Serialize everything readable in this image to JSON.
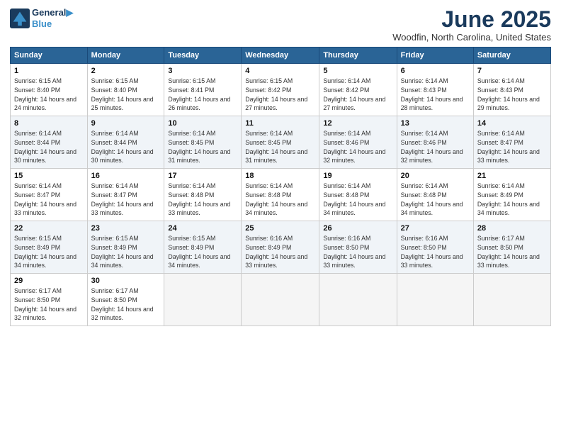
{
  "header": {
    "logo_line1": "General",
    "logo_line2": "Blue",
    "month": "June 2025",
    "location": "Woodfin, North Carolina, United States"
  },
  "columns": [
    "Sunday",
    "Monday",
    "Tuesday",
    "Wednesday",
    "Thursday",
    "Friday",
    "Saturday"
  ],
  "weeks": [
    [
      {
        "day": "1",
        "sunrise": "Sunrise: 6:15 AM",
        "sunset": "Sunset: 8:40 PM",
        "daylight": "Daylight: 14 hours and 24 minutes."
      },
      {
        "day": "2",
        "sunrise": "Sunrise: 6:15 AM",
        "sunset": "Sunset: 8:40 PM",
        "daylight": "Daylight: 14 hours and 25 minutes."
      },
      {
        "day": "3",
        "sunrise": "Sunrise: 6:15 AM",
        "sunset": "Sunset: 8:41 PM",
        "daylight": "Daylight: 14 hours and 26 minutes."
      },
      {
        "day": "4",
        "sunrise": "Sunrise: 6:15 AM",
        "sunset": "Sunset: 8:42 PM",
        "daylight": "Daylight: 14 hours and 27 minutes."
      },
      {
        "day": "5",
        "sunrise": "Sunrise: 6:14 AM",
        "sunset": "Sunset: 8:42 PM",
        "daylight": "Daylight: 14 hours and 27 minutes."
      },
      {
        "day": "6",
        "sunrise": "Sunrise: 6:14 AM",
        "sunset": "Sunset: 8:43 PM",
        "daylight": "Daylight: 14 hours and 28 minutes."
      },
      {
        "day": "7",
        "sunrise": "Sunrise: 6:14 AM",
        "sunset": "Sunset: 8:43 PM",
        "daylight": "Daylight: 14 hours and 29 minutes."
      }
    ],
    [
      {
        "day": "8",
        "sunrise": "Sunrise: 6:14 AM",
        "sunset": "Sunset: 8:44 PM",
        "daylight": "Daylight: 14 hours and 30 minutes."
      },
      {
        "day": "9",
        "sunrise": "Sunrise: 6:14 AM",
        "sunset": "Sunset: 8:44 PM",
        "daylight": "Daylight: 14 hours and 30 minutes."
      },
      {
        "day": "10",
        "sunrise": "Sunrise: 6:14 AM",
        "sunset": "Sunset: 8:45 PM",
        "daylight": "Daylight: 14 hours and 31 minutes."
      },
      {
        "day": "11",
        "sunrise": "Sunrise: 6:14 AM",
        "sunset": "Sunset: 8:45 PM",
        "daylight": "Daylight: 14 hours and 31 minutes."
      },
      {
        "day": "12",
        "sunrise": "Sunrise: 6:14 AM",
        "sunset": "Sunset: 8:46 PM",
        "daylight": "Daylight: 14 hours and 32 minutes."
      },
      {
        "day": "13",
        "sunrise": "Sunrise: 6:14 AM",
        "sunset": "Sunset: 8:46 PM",
        "daylight": "Daylight: 14 hours and 32 minutes."
      },
      {
        "day": "14",
        "sunrise": "Sunrise: 6:14 AM",
        "sunset": "Sunset: 8:47 PM",
        "daylight": "Daylight: 14 hours and 33 minutes."
      }
    ],
    [
      {
        "day": "15",
        "sunrise": "Sunrise: 6:14 AM",
        "sunset": "Sunset: 8:47 PM",
        "daylight": "Daylight: 14 hours and 33 minutes."
      },
      {
        "day": "16",
        "sunrise": "Sunrise: 6:14 AM",
        "sunset": "Sunset: 8:47 PM",
        "daylight": "Daylight: 14 hours and 33 minutes."
      },
      {
        "day": "17",
        "sunrise": "Sunrise: 6:14 AM",
        "sunset": "Sunset: 8:48 PM",
        "daylight": "Daylight: 14 hours and 33 minutes."
      },
      {
        "day": "18",
        "sunrise": "Sunrise: 6:14 AM",
        "sunset": "Sunset: 8:48 PM",
        "daylight": "Daylight: 14 hours and 34 minutes."
      },
      {
        "day": "19",
        "sunrise": "Sunrise: 6:14 AM",
        "sunset": "Sunset: 8:48 PM",
        "daylight": "Daylight: 14 hours and 34 minutes."
      },
      {
        "day": "20",
        "sunrise": "Sunrise: 6:14 AM",
        "sunset": "Sunset: 8:48 PM",
        "daylight": "Daylight: 14 hours and 34 minutes."
      },
      {
        "day": "21",
        "sunrise": "Sunrise: 6:14 AM",
        "sunset": "Sunset: 8:49 PM",
        "daylight": "Daylight: 14 hours and 34 minutes."
      }
    ],
    [
      {
        "day": "22",
        "sunrise": "Sunrise: 6:15 AM",
        "sunset": "Sunset: 8:49 PM",
        "daylight": "Daylight: 14 hours and 34 minutes."
      },
      {
        "day": "23",
        "sunrise": "Sunrise: 6:15 AM",
        "sunset": "Sunset: 8:49 PM",
        "daylight": "Daylight: 14 hours and 34 minutes."
      },
      {
        "day": "24",
        "sunrise": "Sunrise: 6:15 AM",
        "sunset": "Sunset: 8:49 PM",
        "daylight": "Daylight: 14 hours and 34 minutes."
      },
      {
        "day": "25",
        "sunrise": "Sunrise: 6:16 AM",
        "sunset": "Sunset: 8:49 PM",
        "daylight": "Daylight: 14 hours and 33 minutes."
      },
      {
        "day": "26",
        "sunrise": "Sunrise: 6:16 AM",
        "sunset": "Sunset: 8:50 PM",
        "daylight": "Daylight: 14 hours and 33 minutes."
      },
      {
        "day": "27",
        "sunrise": "Sunrise: 6:16 AM",
        "sunset": "Sunset: 8:50 PM",
        "daylight": "Daylight: 14 hours and 33 minutes."
      },
      {
        "day": "28",
        "sunrise": "Sunrise: 6:17 AM",
        "sunset": "Sunset: 8:50 PM",
        "daylight": "Daylight: 14 hours and 33 minutes."
      }
    ],
    [
      {
        "day": "29",
        "sunrise": "Sunrise: 6:17 AM",
        "sunset": "Sunset: 8:50 PM",
        "daylight": "Daylight: 14 hours and 32 minutes."
      },
      {
        "day": "30",
        "sunrise": "Sunrise: 6:17 AM",
        "sunset": "Sunset: 8:50 PM",
        "daylight": "Daylight: 14 hours and 32 minutes."
      },
      null,
      null,
      null,
      null,
      null
    ]
  ]
}
